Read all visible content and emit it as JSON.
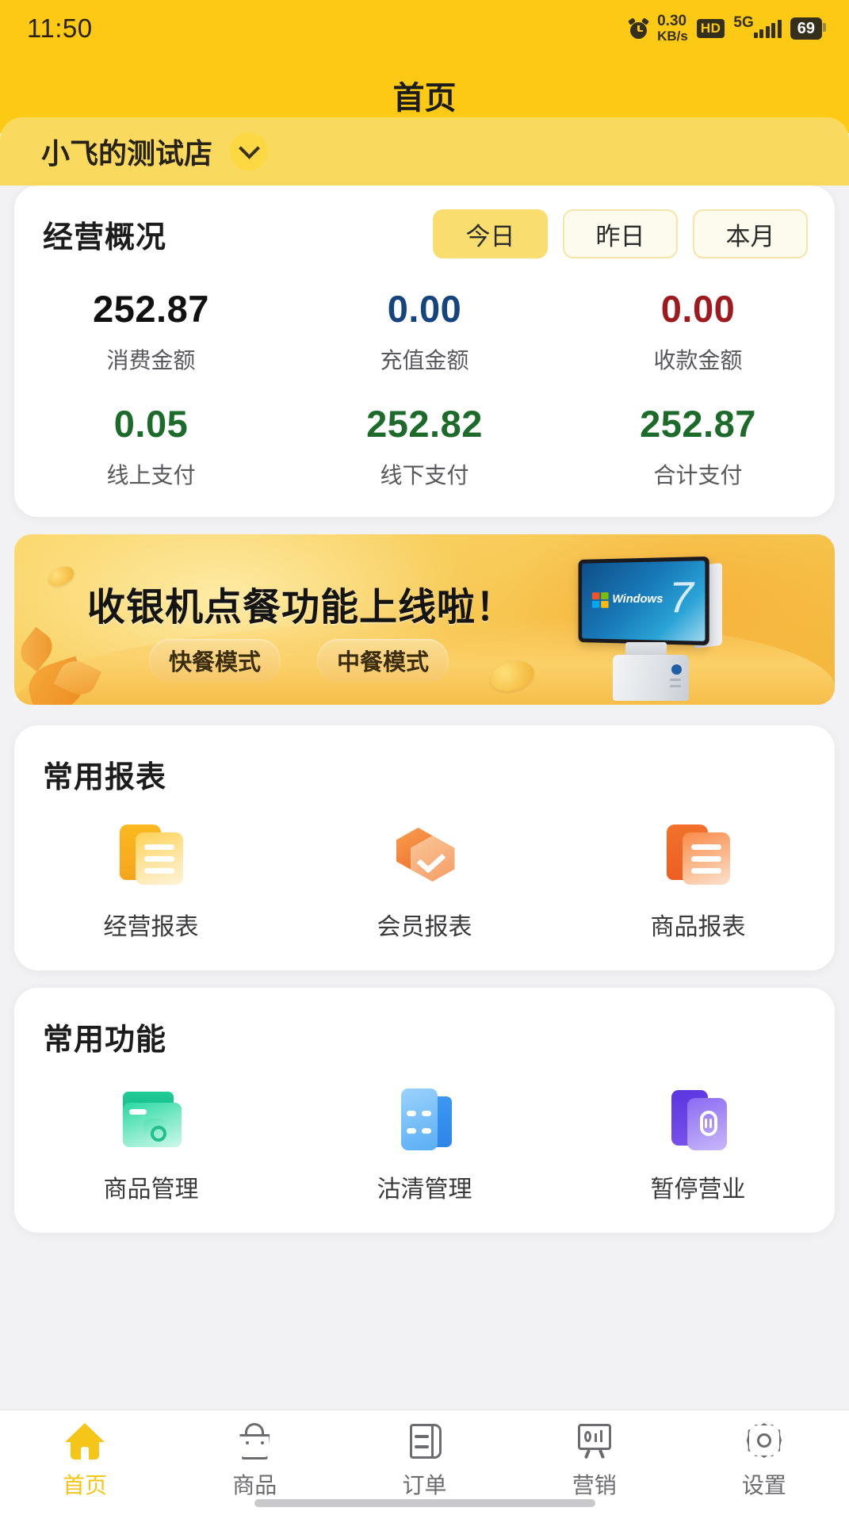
{
  "status_bar": {
    "time": "11:50",
    "alarm_icon": "alarm-clock-icon",
    "net_speed_value": "0.30",
    "net_speed_unit": "KB/s",
    "hd_badge": "HD",
    "network_type": "5G",
    "battery_level": "69"
  },
  "header": {
    "title": "首页",
    "background_color": "#FCC914"
  },
  "store_bar": {
    "store_name": "小飞的测试店",
    "chevron_icon": "chevron-down-icon",
    "background_color": "#FADA5E"
  },
  "overview": {
    "title": "经营概况",
    "range_tabs": [
      {
        "label": "今日",
        "active": true
      },
      {
        "label": "昨日",
        "active": false
      },
      {
        "label": "本月",
        "active": false
      }
    ],
    "stats_row1": [
      {
        "value": "252.87",
        "label": "消费金额",
        "color": "#111111"
      },
      {
        "value": "0.00",
        "label": "充值金额",
        "color": "#15447F"
      },
      {
        "value": "0.00",
        "label": "收款金额",
        "color": "#9E1A1F"
      }
    ],
    "stats_row2": [
      {
        "value": "0.05",
        "label": "线上支付",
        "color": "#1C6B2B"
      },
      {
        "value": "252.82",
        "label": "线下支付",
        "color": "#1C6B2B"
      },
      {
        "value": "252.87",
        "label": "合计支付",
        "color": "#1C6B2B"
      }
    ]
  },
  "banner": {
    "headline": "收银机点餐功能上线啦！",
    "pills": [
      "快餐模式",
      "中餐模式"
    ],
    "device_screen_text": "Windows",
    "device_screen_version": "7",
    "device_icon": "pos-terminal-icon"
  },
  "reports_section": {
    "title": "常用报表",
    "items": [
      {
        "label": "经营报表",
        "icon": "business-report-icon"
      },
      {
        "label": "会员报表",
        "icon": "member-report-icon"
      },
      {
        "label": "商品报表",
        "icon": "product-report-icon"
      }
    ]
  },
  "functions_section": {
    "title": "常用功能",
    "items": [
      {
        "label": "商品管理",
        "icon": "product-management-icon"
      },
      {
        "label": "沽清管理",
        "icon": "soldout-management-icon"
      },
      {
        "label": "暂停营业",
        "icon": "pause-business-icon"
      }
    ]
  },
  "tab_bar": {
    "items": [
      {
        "label": "首页",
        "icon": "home-icon",
        "active": true
      },
      {
        "label": "商品",
        "icon": "shopping-bag-icon",
        "active": false
      },
      {
        "label": "订单",
        "icon": "order-document-icon",
        "active": false
      },
      {
        "label": "营销",
        "icon": "marketing-board-icon",
        "active": false
      },
      {
        "label": "设置",
        "icon": "gear-icon",
        "active": false
      }
    ],
    "active_color": "#F5C518",
    "inactive_color": "#6C6C70"
  }
}
